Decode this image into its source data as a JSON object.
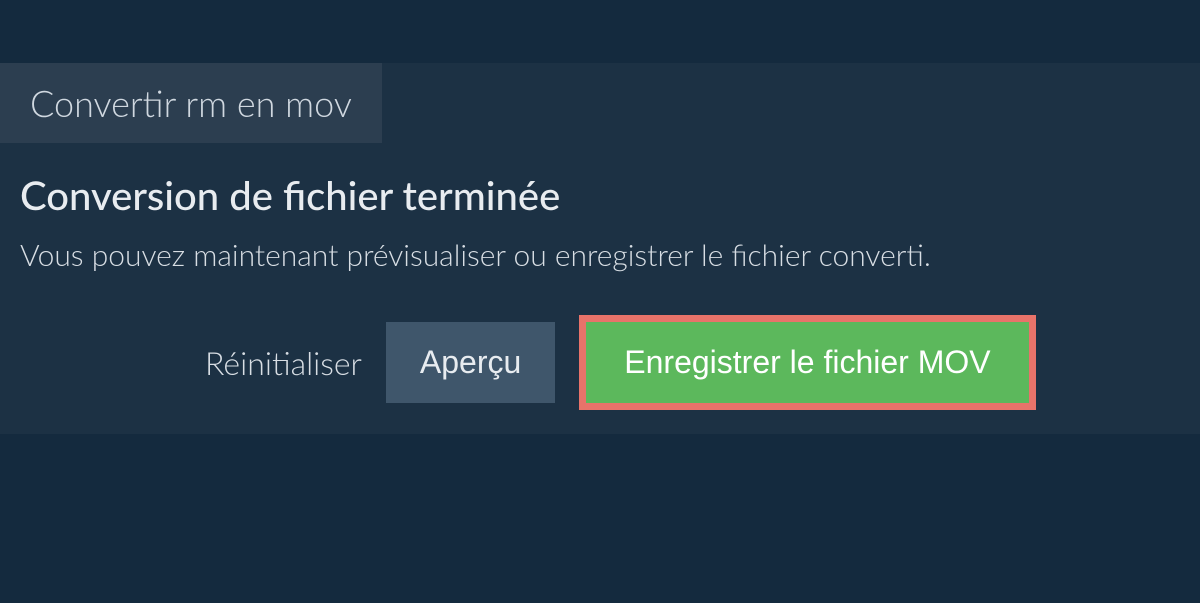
{
  "tab": {
    "label": "Convertir rm en mov"
  },
  "content": {
    "heading": "Conversion de fichier terminée",
    "description": "Vous pouvez maintenant prévisualiser ou enregistrer le fichier converti."
  },
  "actions": {
    "reset_label": "Réinitialiser",
    "preview_label": "Aperçu",
    "save_label": "Enregistrer le fichier MOV"
  },
  "colors": {
    "background": "#142a3e",
    "panel": "#1c3144",
    "tab_bg": "#2c3e50",
    "preview_bg": "#3f566b",
    "save_bg": "#5cb85c",
    "highlight_border": "#e8736a"
  }
}
